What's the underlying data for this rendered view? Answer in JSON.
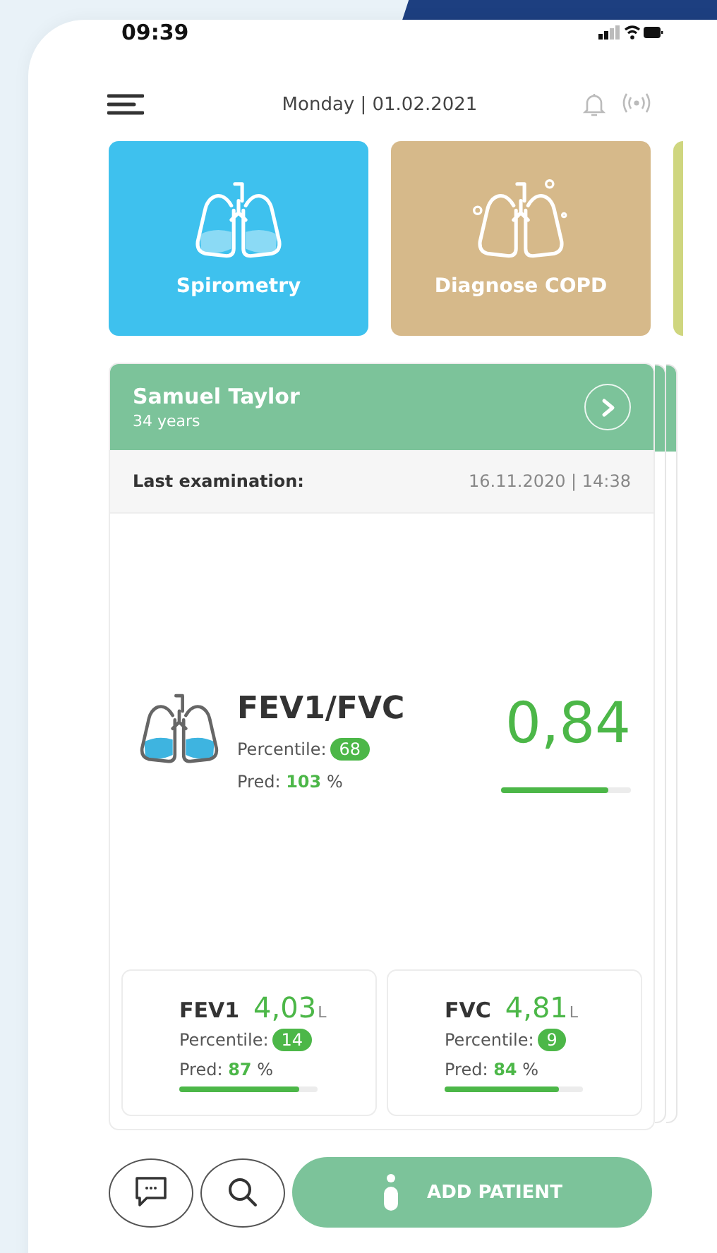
{
  "status_bar": {
    "time": "09:39"
  },
  "header": {
    "date": "Monday | 01.02.2021"
  },
  "tiles": [
    {
      "label": "Spirometry",
      "color": "#3ec1ee",
      "kind": "spirometry"
    },
    {
      "label": "Diagnose COPD",
      "color": "#d6b98a",
      "kind": "copd"
    },
    {
      "color": "#cfd67f",
      "kind": "partial"
    }
  ],
  "patient": {
    "name": "Samuel Taylor",
    "age": "34 years",
    "last_exam_label": "Last examination:",
    "last_exam_date": "16.11.2020 | 14:38"
  },
  "main_metric": {
    "name": "FEV1/FVC",
    "value": "0,84",
    "percentile_label": "Percentile:",
    "percentile": "68",
    "pred_label": "Pred:",
    "pred": "103",
    "pred_unit": "%",
    "level": 0.83
  },
  "metrics": [
    {
      "name": "FEV1",
      "value": "4,03",
      "unit": "L",
      "percentile_label": "Percentile:",
      "percentile": "14",
      "pred_label": "Pred:",
      "pred": "87",
      "pred_unit": "%",
      "level": 0.87
    },
    {
      "name": "FVC",
      "value": "4,81",
      "unit": "L",
      "percentile_label": "Percentile:",
      "percentile": "9",
      "pred_label": "Pred:",
      "pred": "84",
      "pred_unit": "%",
      "level": 0.83
    }
  ],
  "actions": {
    "add_patient": "ADD PATIENT"
  }
}
